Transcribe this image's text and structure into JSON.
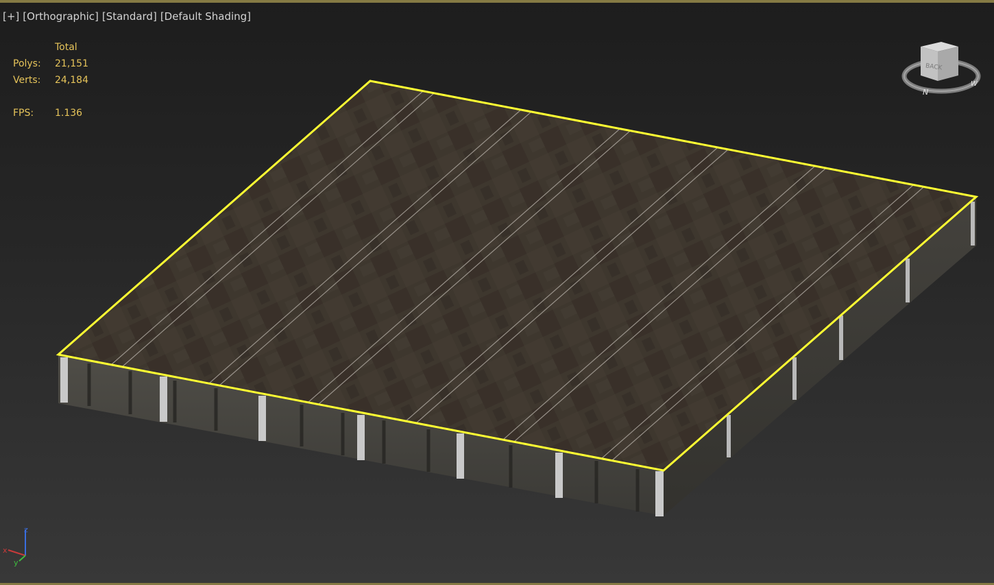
{
  "viewport": {
    "labels": {
      "plus": "[+]",
      "projection": "[Orthographic]",
      "renderer": "[Standard]",
      "shading": "[Default Shading]"
    },
    "stats": {
      "column_header": "Total",
      "polys_label": "Polys:",
      "polys_value": "21,151",
      "verts_label": "Verts:",
      "verts_value": "24,184",
      "fps_label": "FPS:",
      "fps_value": "1.136"
    },
    "viewcube": {
      "face_label": "BACK",
      "compass_n": "N",
      "compass_w": "W"
    },
    "axis": {
      "x": "x",
      "y": "y",
      "z": "z"
    },
    "colors": {
      "selection_outline": "#ffff33",
      "stats_text": "#e6c45a",
      "label_text": "#d4d4d4",
      "active_border": "#857a44",
      "axis_x": "#c83a3a",
      "axis_y": "#3fbf3f",
      "axis_z": "#3a6ee0"
    }
  }
}
